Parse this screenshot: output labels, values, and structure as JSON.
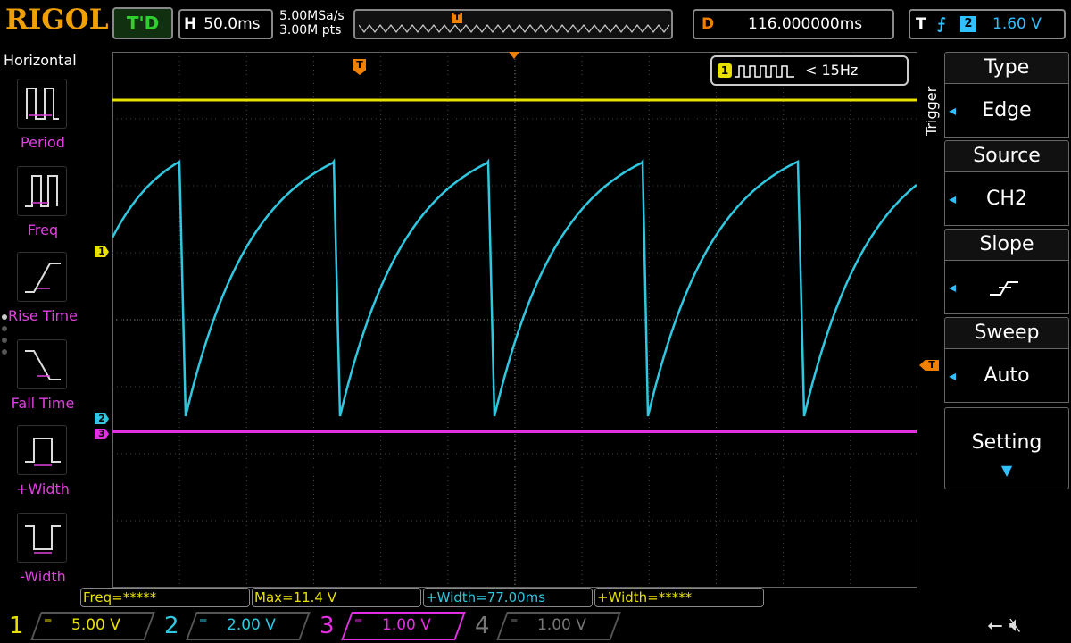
{
  "brand": "RIGOL",
  "status": "T'D",
  "horizontal": {
    "label": "H",
    "scale": "50.0ms"
  },
  "sample": {
    "rate": "5.00MSa/s",
    "points": "3.00M pts"
  },
  "delay": {
    "label": "D",
    "value": "116.000000ms"
  },
  "trigger_info": {
    "label": "T",
    "channel": "2",
    "level": "1.60 V"
  },
  "counter": {
    "channel": "1",
    "value": "< 15Hz"
  },
  "markers": {
    "ch1": "1",
    "ch2": "2",
    "ch3": "3",
    "trig": "T"
  },
  "left_menu": {
    "title": "Horizontal",
    "items": [
      {
        "label": "Period",
        "icon": "period-icon"
      },
      {
        "label": "Freq",
        "icon": "freq-icon"
      },
      {
        "label": "Rise Time",
        "icon": "rise-time-icon"
      },
      {
        "label": "Fall Time",
        "icon": "fall-time-icon"
      },
      {
        "label": "+Width",
        "icon": "positive-width-icon"
      },
      {
        "label": "-Width",
        "icon": "negative-width-icon"
      }
    ]
  },
  "measurements": [
    "Freq=*****",
    "Max=11.4 V",
    "+Width=77.00ms",
    "+Width=*****"
  ],
  "channels": [
    {
      "num": "1",
      "value": "5.00 V",
      "color": "#e8e000"
    },
    {
      "num": "2",
      "value": "2.00 V",
      "color": "#30c8e0"
    },
    {
      "num": "3",
      "value": "1.00 V",
      "color": "#e030e0"
    },
    {
      "num": "4",
      "value": "1.00 V",
      "color": "#777777"
    }
  ],
  "trigger_menu": {
    "title": "Trigger",
    "type": {
      "label": "Type",
      "value": "Edge"
    },
    "source": {
      "label": "Source",
      "value": "CH2"
    },
    "slope": {
      "label": "Slope",
      "value": "rising-edge-icon"
    },
    "sweep": {
      "label": "Sweep",
      "value": "Auto"
    },
    "setting": {
      "label": "Setting"
    }
  },
  "colors": {
    "ch1": "#e8e000",
    "ch2": "#30c8e0",
    "ch3": "#e030e0",
    "trigger": "#f08000",
    "accent": "#30c0ff"
  }
}
